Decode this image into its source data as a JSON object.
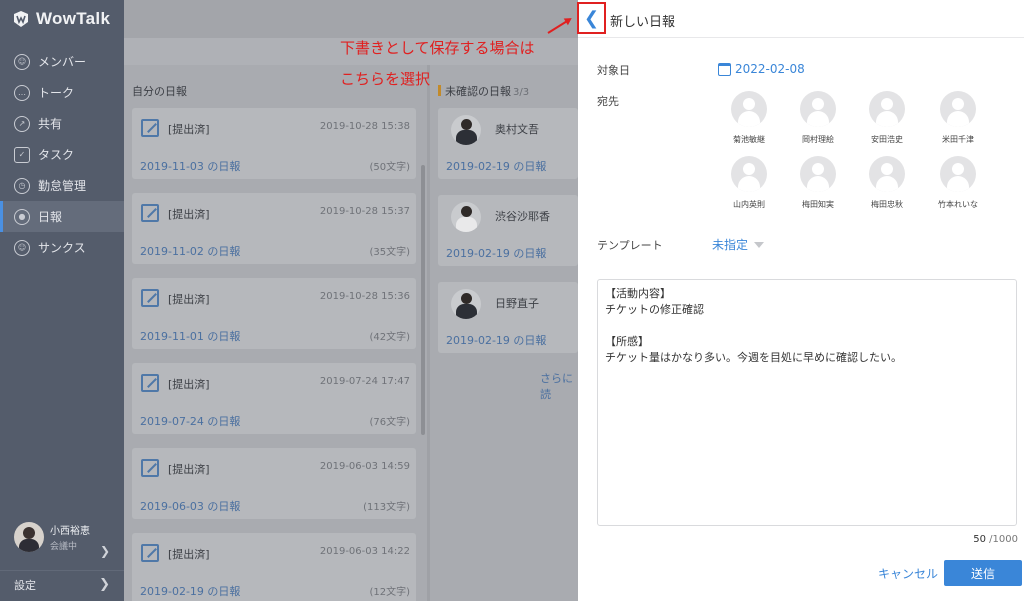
{
  "app": {
    "name": "WowTalk"
  },
  "nav": [
    {
      "label": "メンバー",
      "icon": "person-icon"
    },
    {
      "label": "トーク",
      "icon": "chat-icon"
    },
    {
      "label": "共有",
      "icon": "share-icon"
    },
    {
      "label": "タスク",
      "icon": "task-icon"
    },
    {
      "label": "勤怠管理",
      "icon": "clock-icon"
    },
    {
      "label": "日報",
      "icon": "report-icon",
      "active": true
    },
    {
      "label": "サンクス",
      "icon": "thanks-icon"
    }
  ],
  "user": {
    "name": "小西裕恵",
    "status": "会議中"
  },
  "settings_label": "設定",
  "left_column": {
    "title": "自分の日報",
    "items": [
      {
        "status": "[提出済]",
        "time": "2019-10-28 15:38",
        "title": "2019-11-03 の日報",
        "chars": "(50文字)"
      },
      {
        "status": "[提出済]",
        "time": "2019-10-28 15:37",
        "title": "2019-11-02 の日報",
        "chars": "(35文字)"
      },
      {
        "status": "[提出済]",
        "time": "2019-10-28 15:36",
        "title": "2019-11-01 の日報",
        "chars": "(42文字)"
      },
      {
        "status": "[提出済]",
        "time": "2019-07-24 17:47",
        "title": "2019-07-24 の日報",
        "chars": "(76文字)"
      },
      {
        "status": "[提出済]",
        "time": "2019-06-03 14:59",
        "title": "2019-06-03 の日報",
        "chars": "(113文字)"
      },
      {
        "status": "[提出済]",
        "time": "2019-06-03 14:22",
        "title": "2019-02-19 の日報",
        "chars": "(12文字)"
      }
    ]
  },
  "right_column": {
    "title": "未確認の日報",
    "count": "3/3",
    "items": [
      {
        "name": "奥村文吾",
        "title": "2019-02-19 の日報"
      },
      {
        "name": "渋谷沙耶香",
        "title": "2019-02-19 の日報"
      },
      {
        "name": "日野直子",
        "title": "2019-02-19 の日報"
      }
    ],
    "more": "さらに読"
  },
  "annotation": {
    "line1": "下書きとして保存する場合は",
    "line2": "こちらを選択",
    "color": "#e02020"
  },
  "panel": {
    "title": "新しい日報",
    "date_label": "対象日",
    "date_value": "2022-02-08",
    "recipient_label": "宛先",
    "recipients": [
      "菊池敏継",
      "岡村理絵",
      "安田浩史",
      "米田千津",
      "山内英則",
      "梅田知実",
      "梅田忠秋",
      "竹本れいな"
    ],
    "template_label": "テンプレート",
    "template_value": "未指定",
    "body": "【活動内容】\nチケットの修正確認\n\n【所感】\nチケット量はかなり多い。今週を目処に早めに確認したい。",
    "counter_current": "50",
    "counter_max": " /1000",
    "cancel": "キャンセル",
    "send": "送信"
  },
  "colors": {
    "accent": "#3a86d8",
    "sidebar": "#545c6b"
  }
}
